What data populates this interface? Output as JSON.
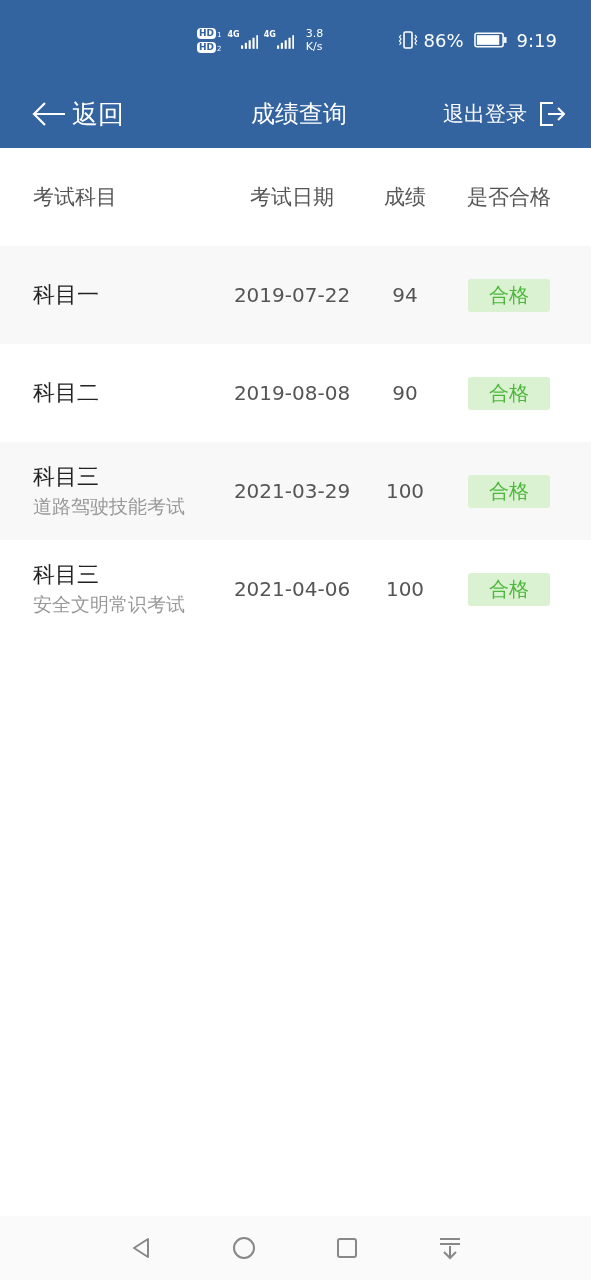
{
  "status_bar": {
    "sims": [
      {
        "badge": "HD",
        "slot": "1"
      },
      {
        "badge": "HD",
        "slot": "2"
      }
    ],
    "networks": [
      "4G",
      "4G"
    ],
    "speed_value": "3.8",
    "speed_unit": "K/s",
    "battery_percent": "86%",
    "time": "9:19"
  },
  "header": {
    "back": "返回",
    "title": "成绩查询",
    "logout": "退出登录"
  },
  "table": {
    "columns": [
      "考试科目",
      "考试日期",
      "成绩",
      "是否合格"
    ],
    "rows": [
      {
        "subject": "科目一",
        "date": "2019-07-22",
        "score": "94",
        "result": "合格",
        "passed": true
      },
      {
        "subject": "科目二",
        "date": "2019-08-08",
        "score": "90",
        "result": "合格",
        "passed": true
      },
      {
        "subject": "科目三",
        "subtitle": "道路驾驶技能考试",
        "date": "2021-03-29",
        "score": "100",
        "result": "合格",
        "passed": true
      },
      {
        "subject": "科目三",
        "subtitle": "安全文明常识考试",
        "date": "2021-04-06",
        "score": "100",
        "result": "合格",
        "passed": true
      }
    ]
  }
}
